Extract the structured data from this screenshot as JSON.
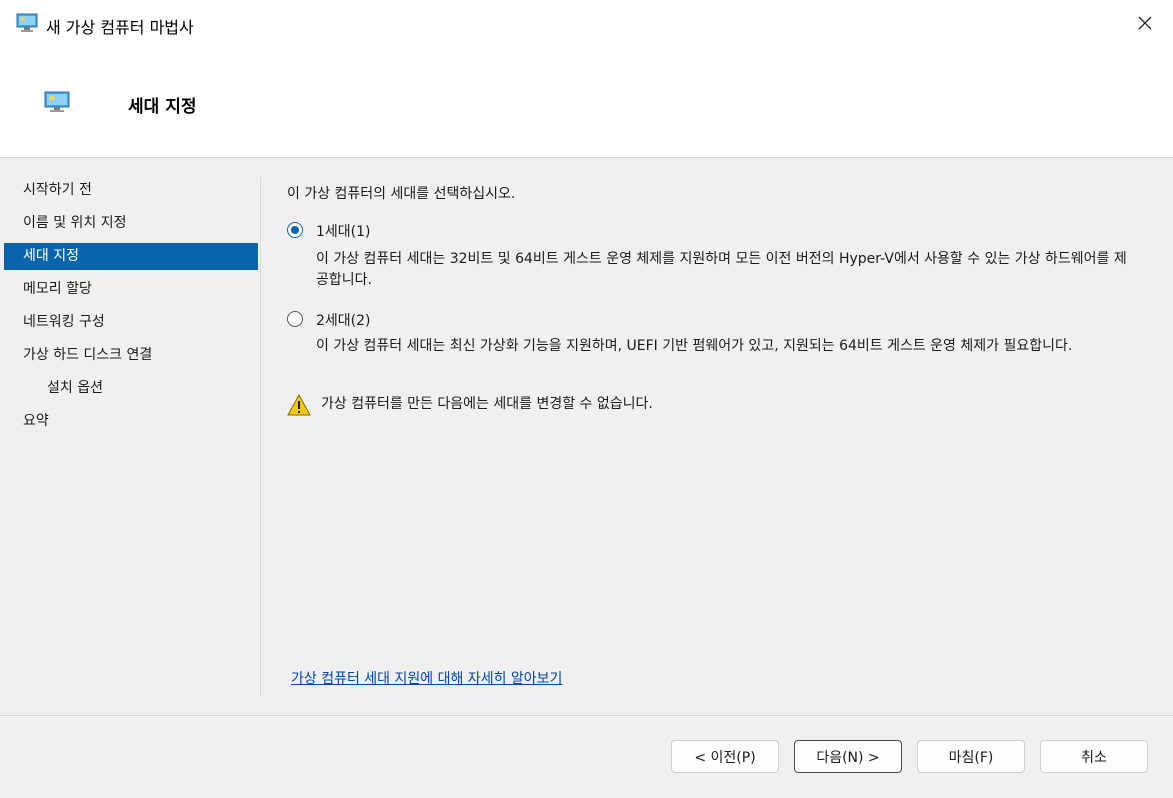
{
  "window": {
    "title": "새 가상 컴퓨터 마법사",
    "close_icon": "close-icon"
  },
  "header": {
    "title": "세대 지정",
    "icon": "virtual-machine-icon"
  },
  "nav": {
    "items": [
      {
        "label": "시작하기 전",
        "selected": false,
        "sub": false
      },
      {
        "label": "이름 및 위치 지정",
        "selected": false,
        "sub": false
      },
      {
        "label": "세대 지정",
        "selected": true,
        "sub": false
      },
      {
        "label": "메모리 할당",
        "selected": false,
        "sub": false
      },
      {
        "label": "네트워킹 구성",
        "selected": false,
        "sub": false
      },
      {
        "label": "가상 하드 디스크 연결",
        "selected": false,
        "sub": false
      },
      {
        "label": "설치 옵션",
        "selected": false,
        "sub": true
      },
      {
        "label": "요약",
        "selected": false,
        "sub": false
      }
    ]
  },
  "content": {
    "prompt": "이 가상 컴퓨터의 세대를 선택하십시오.",
    "gen1": {
      "label": "1세대(1)",
      "checked": true,
      "description": "이 가상 컴퓨터 세대는 32비트 및 64비트 게스트 운영 체제를 지원하며 모든 이전 버전의 Hyper-V에서 사용할 수 있는 가상 하드웨어를 제공합니다."
    },
    "gen2": {
      "label": "2세대(2)",
      "checked": false,
      "description": "이 가상 컴퓨터 세대는 최신 가상화 기능을 지원하며, UEFI 기반 펌웨어가 있고, 지원되는 64비트 게스트 운영 체제가 필요합니다."
    },
    "warning": "가상 컴퓨터를 만든 다음에는 세대를 변경할 수 없습니다.",
    "warning_icon": "warning-icon",
    "learn_link": "가상 컴퓨터 세대 지원에 대해 자세히 알아보기"
  },
  "buttons": {
    "previous": "< 이전(P)",
    "next": "다음(N) >",
    "finish": "마침(F)",
    "cancel": "취소"
  },
  "colors": {
    "accent": "#0a64ad",
    "link": "#0645ad",
    "warning": "#f2c811"
  }
}
